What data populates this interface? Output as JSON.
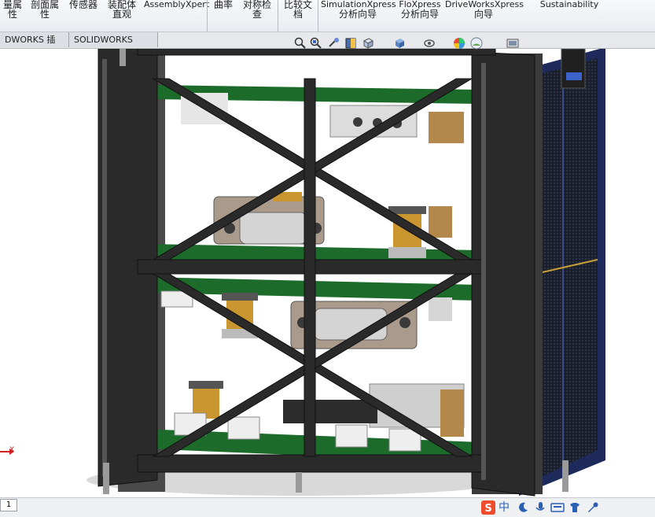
{
  "ribbon": {
    "groups": [
      {
        "line1": "量属",
        "line2": "性"
      },
      {
        "line1": "剖面属",
        "line2": "性"
      },
      {
        "line1": "传感器",
        "line2": ""
      },
      {
        "line1": "装配体",
        "line2": "直观"
      },
      {
        "line1": "AssemblyXpert",
        "line2": ""
      },
      {
        "line1": "曲率",
        "line2": ""
      },
      {
        "line1": "对称检",
        "line2": "查"
      },
      {
        "line1": "比较文",
        "line2": "档"
      },
      {
        "line1": "SimulationXpress",
        "line2": "分析向导"
      },
      {
        "line1": "FloXpress",
        "line2": "分析向导"
      },
      {
        "line1": "DriveWorksXpress",
        "line2": "向导"
      },
      {
        "line1": "Sustainability",
        "line2": ""
      }
    ]
  },
  "tabs": [
    {
      "label": "DWORKS 插件"
    },
    {
      "label": "SOLIDWORKS MBD"
    }
  ],
  "viewport": {
    "axis_label": "X"
  },
  "statusbar": {
    "page_number": "1",
    "ime_label": "中"
  },
  "colors": {
    "ribbon_bg": "#eceff2",
    "frame": "#2b2b2b",
    "pcb": "#1f6e2c",
    "solar_panel": "#2a3566",
    "brass": "#c9962f"
  },
  "icons": [
    "zoom-to-fit-icon",
    "zoom-area-icon",
    "previous-view-icon",
    "section-view-icon",
    "view-orientation-icon",
    "display-style-icon",
    "hide-show-icon",
    "edit-appearance-icon",
    "apply-scene-icon",
    "view-settings-icon",
    "monitor-icon",
    "sogou-ime-icon",
    "moon-icon",
    "microphone-icon",
    "keyboard-icon",
    "skin-icon",
    "tools-icon"
  ]
}
